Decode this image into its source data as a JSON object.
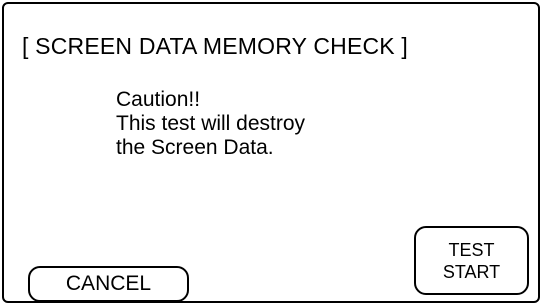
{
  "dialog": {
    "title": "[ SCREEN DATA MEMORY CHECK ]",
    "message_lines": [
      "Caution!!",
      "This test will destroy",
      "the Screen Data."
    ]
  },
  "buttons": {
    "cancel_label": "CANCEL",
    "test_start_line1": "TEST",
    "test_start_line2": "START"
  }
}
